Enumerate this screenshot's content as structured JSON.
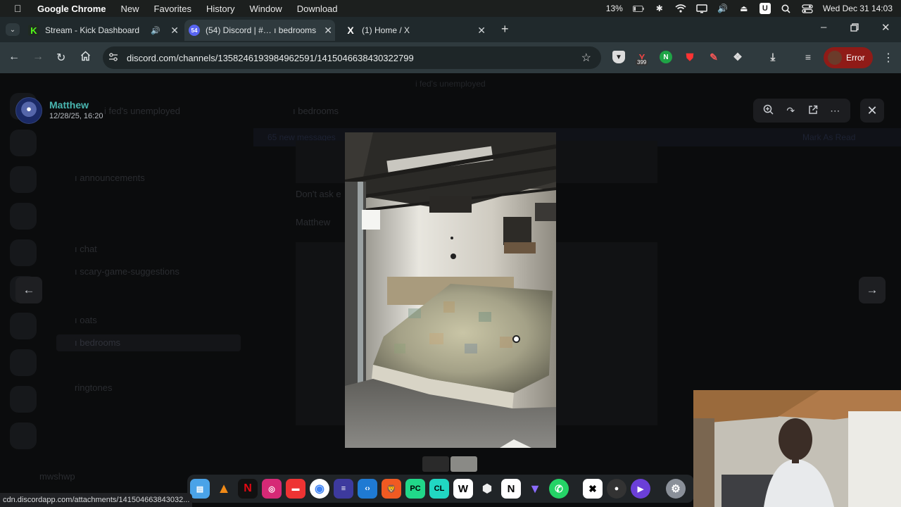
{
  "menubar": {
    "app_name": "Google Chrome",
    "items": [
      "New",
      "Favorites",
      "History",
      "Window",
      "Download"
    ],
    "battery": "13%",
    "user_badge": "U",
    "datetime": "Wed Dec 31  14:03"
  },
  "tabs": [
    {
      "title": "Stream - Kick Dashboard",
      "favicon": "K",
      "active": false,
      "audio": true
    },
    {
      "title": "(54) Discord | #… ı bedrooms",
      "favicon": "54",
      "active": true
    },
    {
      "title": "(1) Home / X",
      "favicon": "X",
      "active": false
    }
  ],
  "toolbar": {
    "url": "discord.com/channels/1358246193984962591/1415046638430322799",
    "extension_badge": "399",
    "error_label": "Error"
  },
  "viewer": {
    "uploader_name": "Matthew",
    "timestamp": "12/28/25, 16:20",
    "tools": [
      "zoom-in-icon",
      "rotate-icon",
      "open-external-icon",
      "more-icon"
    ]
  },
  "background_discord": {
    "server_name": "i fed's unemployed",
    "channel_header": "ı bedrooms",
    "channels": [
      "ı announcements",
      "ı chat",
      "ı scary-game-suggestions",
      "ı oats",
      "ı bedrooms",
      "ringtones"
    ],
    "banner": "65 new messages",
    "mark_read": "Mark As Read",
    "ghost_user": "Matthew",
    "ghost_text": "Don't ask e",
    "footer_user": "mwshwp"
  },
  "status_url": "cdn.discordapp.com/attachments/141504663843032...",
  "colors": {
    "accent_name": "#49b6b0",
    "error": "#8f1b17",
    "tab_active": "#2f3a3e"
  }
}
